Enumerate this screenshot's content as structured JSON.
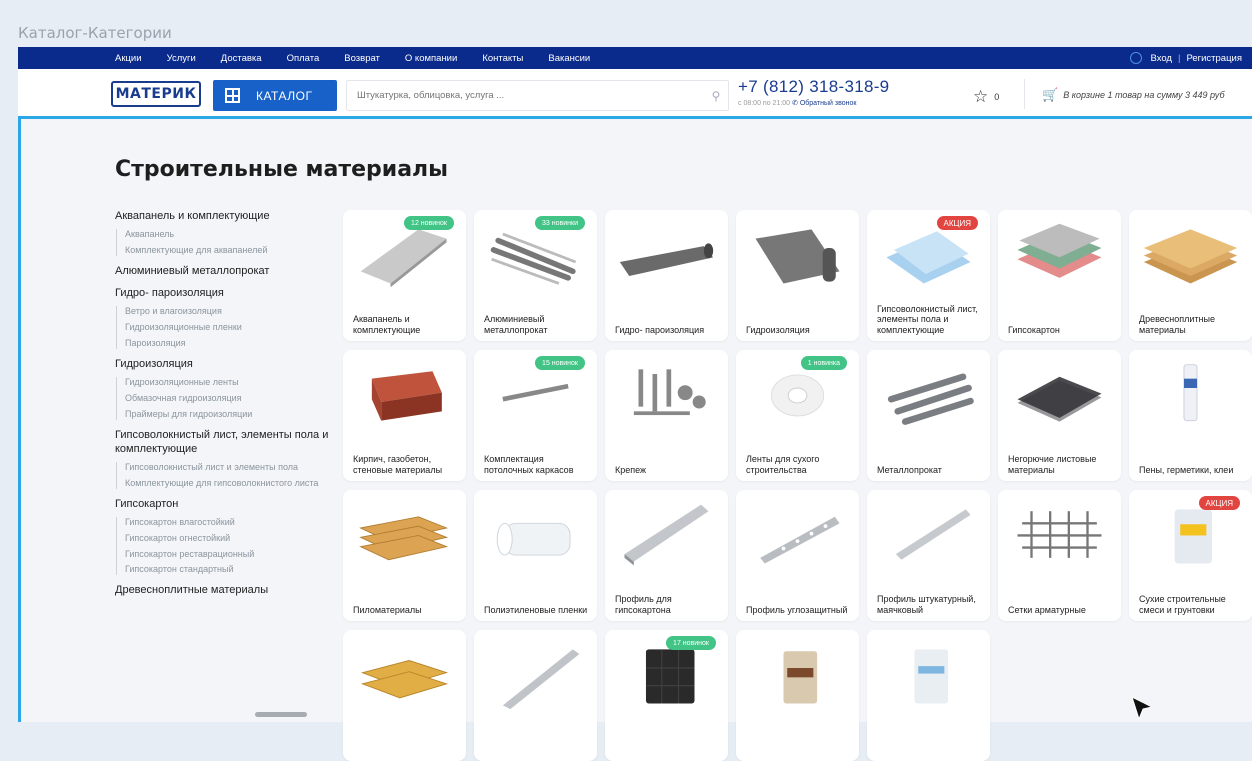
{
  "window": {
    "title": "Каталог-Категории"
  },
  "topnav": {
    "links": [
      "Акции",
      "Услуги",
      "Доставка",
      "Оплата",
      "Возврат",
      "О компании",
      "Контакты",
      "Вакансии"
    ],
    "login": "Вход",
    "register": "Регистрация"
  },
  "header": {
    "logo_text": "МАТЕРИК",
    "catalog_label": "КАТАЛОГ",
    "search_placeholder": "Штукатурка, облицовка, услуга ...",
    "phone": "+7 (812) 318-318-9",
    "hours": "с 08:00 по 21:00",
    "callback": "Обратный звонок",
    "fav_count": "0",
    "cart_text": "В корзине 1 товар на сумму 3 449 руб"
  },
  "page": {
    "title": "Строительные материалы"
  },
  "sidebar": [
    {
      "title": "Аквапанель и комплектующие",
      "items": [
        "Аквапанель",
        "Комплектующие для аквапанелей"
      ]
    },
    {
      "title": "Алюминиевый металлопрокат",
      "items": []
    },
    {
      "title": "Гидро- пароизоляция",
      "items": [
        "Ветро и влагоизоляция",
        "Гидроизоляционные пленки",
        "Пароизоляция"
      ]
    },
    {
      "title": "Гидроизоляция",
      "items": [
        "Гидроизоляционные ленты",
        "Обмазочная гидроизоляция",
        "Праймеры для гидроизоляции"
      ]
    },
    {
      "title": "Гипсоволокнистый лист, элементы пола и комплектующие",
      "items": [
        "Гипсоволокнистый лист и элементы пола",
        "Комплектующие для гипсоволокнистого листа"
      ]
    },
    {
      "title": "Гипсокартон",
      "items": [
        "Гипсокартон влагостойкий",
        "Гипсокартон огнестойкий",
        "Гипсокартон реставрационный",
        "Гипсокартон стандартный"
      ]
    },
    {
      "title": "Древесноплитные материалы",
      "items": []
    }
  ],
  "cards": [
    {
      "label": "Аквапанель и комплектующие",
      "badge": "12 новинок",
      "badge_type": "green",
      "icon": "board-icon"
    },
    {
      "label": "Алюминиевый металлопрокат",
      "badge": "33 новинки",
      "badge_type": "green",
      "icon": "pipes-icon"
    },
    {
      "label": "Гидро- пароизоляция",
      "badge": "",
      "badge_type": "",
      "icon": "membrane-icon"
    },
    {
      "label": "Гидроизоляция",
      "badge": "",
      "badge_type": "",
      "icon": "roll-icon"
    },
    {
      "label": "Гипсоволокнистый лист, элементы пола и комплектующие",
      "badge": "АКЦИЯ",
      "badge_type": "red",
      "icon": "sheets-blue-icon"
    },
    {
      "label": "Гипсокартон",
      "badge": "",
      "badge_type": "",
      "icon": "drywall-icon"
    },
    {
      "label": "Древесноплитные материалы",
      "badge": "",
      "badge_type": "",
      "icon": "osb-icon"
    },
    {
      "label": "Кирпич, газобетон, стеновые материалы",
      "badge": "",
      "badge_type": "",
      "icon": "brick-icon"
    },
    {
      "label": "Комплектация потолочных каркасов",
      "badge": "15 новинок",
      "badge_type": "green",
      "icon": "hanger-icon"
    },
    {
      "label": "Крепеж",
      "badge": "",
      "badge_type": "",
      "icon": "fasteners-icon"
    },
    {
      "label": "Ленты для сухого строительства",
      "badge": "1 новинка",
      "badge_type": "green",
      "icon": "tape-icon"
    },
    {
      "label": "Металлопрокат",
      "badge": "",
      "badge_type": "",
      "icon": "rebar-icon"
    },
    {
      "label": "Негорючие листовые материалы",
      "badge": "",
      "badge_type": "",
      "icon": "dark-sheets-icon"
    },
    {
      "label": "Пены, герметики, клеи",
      "badge": "",
      "badge_type": "",
      "icon": "sealant-icon"
    },
    {
      "label": "Пиломатериалы",
      "badge": "",
      "badge_type": "",
      "icon": "lumber-icon"
    },
    {
      "label": "Полиэтиленовые пленки",
      "badge": "",
      "badge_type": "",
      "icon": "film-roll-icon"
    },
    {
      "label": "Профиль для гипсокартона",
      "badge": "",
      "badge_type": "",
      "icon": "profile-icon"
    },
    {
      "label": "Профиль углозащитный",
      "badge": "",
      "badge_type": "",
      "icon": "corner-profile-icon"
    },
    {
      "label": "Профиль штукатурный, маячковый",
      "badge": "",
      "badge_type": "",
      "icon": "beacon-profile-icon"
    },
    {
      "label": "Сетки арматурные",
      "badge": "",
      "badge_type": "",
      "icon": "mesh-icon"
    },
    {
      "label": "Сухие строительные смеси и грунтовки",
      "badge": "АКЦИЯ",
      "badge_type": "red",
      "icon": "glue-bag-icon"
    },
    {
      "label": "",
      "badge": "",
      "badge_type": "",
      "icon": "insulation-icon"
    },
    {
      "label": "",
      "badge": "",
      "badge_type": "",
      "icon": "rail-profile-icon"
    },
    {
      "label": "",
      "badge": "17 новинок",
      "badge_type": "green",
      "icon": "acoustic-panel-icon"
    },
    {
      "label": "",
      "badge": "",
      "badge_type": "",
      "icon": "cement-bag-icon"
    },
    {
      "label": "",
      "badge": "",
      "badge_type": "",
      "icon": "plaster-bag-icon"
    }
  ]
}
